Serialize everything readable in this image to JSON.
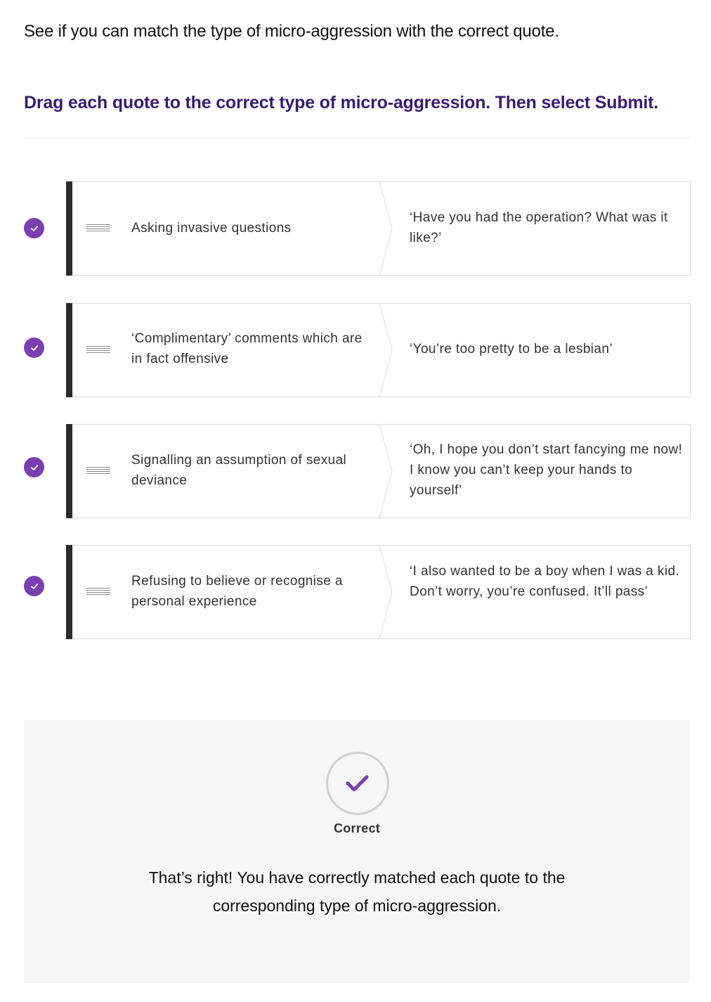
{
  "intro": "See if you can match the type of micro-aggression with the correct quote.",
  "instruction": "Drag each quote to the correct type of micro-aggression. Then select Submit.",
  "pairs": [
    {
      "type": "Asking invasive questions",
      "quote": "‘Have you had the operation? What was it like?’",
      "status_icon": "check-icon"
    },
    {
      "type": "‘Complimentary’ comments which are in fact offensive",
      "quote": "‘You’re too pretty to be a lesbian’",
      "status_icon": "check-icon"
    },
    {
      "type": "Signalling an assumption of sexual deviance",
      "quote": "‘Oh, I hope you don’t start fancying me now! I know you can’t keep your hands to yourself’",
      "status_icon": "check-icon"
    },
    {
      "type": "Refusing to believe or recognise a personal experience",
      "quote": "‘I also wanted to be a boy when I was a kid. Don’t worry, you’re confused. It’ll pass’",
      "status_icon": "check-icon"
    }
  ],
  "feedback": {
    "label": "Correct",
    "message": "That’s right! You have correctly matched each quote to the corresponding type of micro-aggression."
  },
  "colors": {
    "accent": "#7a3eb1",
    "instruction": "#3a1a72",
    "card_bar": "#2b2b2b",
    "feedback_bg": "#f6f6f6"
  }
}
